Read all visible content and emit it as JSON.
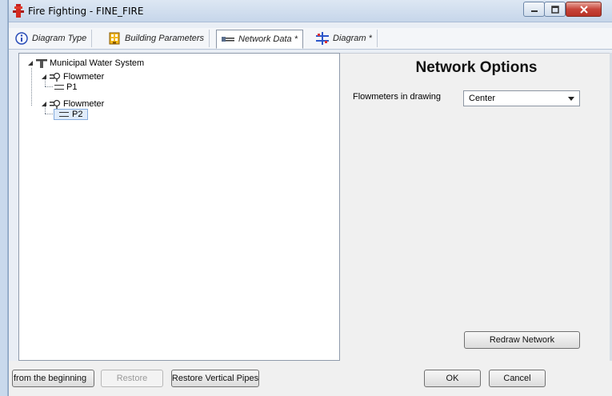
{
  "window": {
    "title": "Fire Fighting - FINE_FIRE",
    "controls": {
      "minimize": "minimize-icon",
      "maximize": "maximize-icon",
      "close": "close-icon"
    },
    "close_color": "#c7453a"
  },
  "tabs": [
    {
      "label": "Diagram Type",
      "icon": "info-icon",
      "active": false
    },
    {
      "label": "Building Parameters",
      "icon": "building-icon",
      "active": false
    },
    {
      "label": "Network Data *",
      "icon": "network-icon",
      "active": true
    },
    {
      "label": "Diagram *",
      "icon": "diagram-icon",
      "active": false
    }
  ],
  "tree": {
    "root": {
      "label": "Municipal Water System",
      "icon": "hydrant-icon"
    },
    "nodes": [
      {
        "label": "Flowmeter",
        "icon": "flowmeter-icon",
        "children": [
          {
            "label": "P1",
            "icon": "pipe-icon",
            "selected": false
          }
        ]
      },
      {
        "label": "Flowmeter",
        "icon": "flowmeter-icon",
        "children": [
          {
            "label": "P2",
            "icon": "pipe-icon",
            "selected": true
          }
        ]
      }
    ]
  },
  "options": {
    "title": "Network Options",
    "flowmeters_label": "Flowmeters in drawing",
    "flowmeters_value": "Center",
    "redraw_label": "Redraw Network"
  },
  "footer": {
    "from_beginning": "from the beginning",
    "restore": "Restore",
    "restore_vertical": "Restore Vertical Pipes",
    "ok": "OK",
    "cancel": "Cancel"
  }
}
